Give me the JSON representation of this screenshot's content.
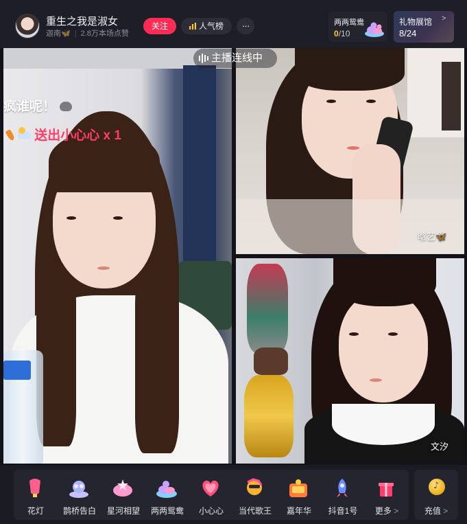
{
  "header": {
    "host_name": "重生之我是淑女",
    "host_location": "迦南🦋",
    "host_likes": "2.8万本场点赞",
    "follow_label": "关注",
    "rank_label": "人气榜",
    "more_label": "···",
    "task": {
      "title": "两两鸳鸯",
      "current": "0",
      "total": "/10"
    },
    "gallery": {
      "title": "礼物展馆",
      "count": "8/24",
      "arrow": ">"
    }
  },
  "stream": {
    "link_status": "主播连线中",
    "chat_overlay": "疯谁呢！",
    "gift_overlay": "送出小心心 x 1",
    "guests": [
      {
        "name": "晗艺🦋"
      },
      {
        "name": "文汐"
      }
    ]
  },
  "gift_bar": {
    "items": [
      {
        "label": "花灯",
        "icon": "lantern-icon",
        "color": "#ff5f8a"
      },
      {
        "label": "鹊桥告白",
        "icon": "bridge-icon",
        "color": "#a5b7ff"
      },
      {
        "label": "星河相望",
        "icon": "galaxy-icon",
        "color": "#ff9ad0"
      },
      {
        "label": "两两鸳鸯",
        "icon": "ducks-icon",
        "color": "#ffa5c8"
      },
      {
        "label": "小心心",
        "icon": "heart-icon",
        "color": "#ff4f7a"
      },
      {
        "label": "当代歌王",
        "icon": "singer-icon",
        "color": "#ffb02e"
      },
      {
        "label": "嘉年华",
        "icon": "carnival-icon",
        "color": "#ff7a3d"
      },
      {
        "label": "抖音1号",
        "icon": "rocket-icon",
        "color": "#6c8cff"
      },
      {
        "label": "更多",
        "icon": "gift-box-icon",
        "color": "#ff3d6a",
        "arrow": ">"
      }
    ],
    "recharge_label": "充值",
    "recharge_arrow": ">"
  }
}
